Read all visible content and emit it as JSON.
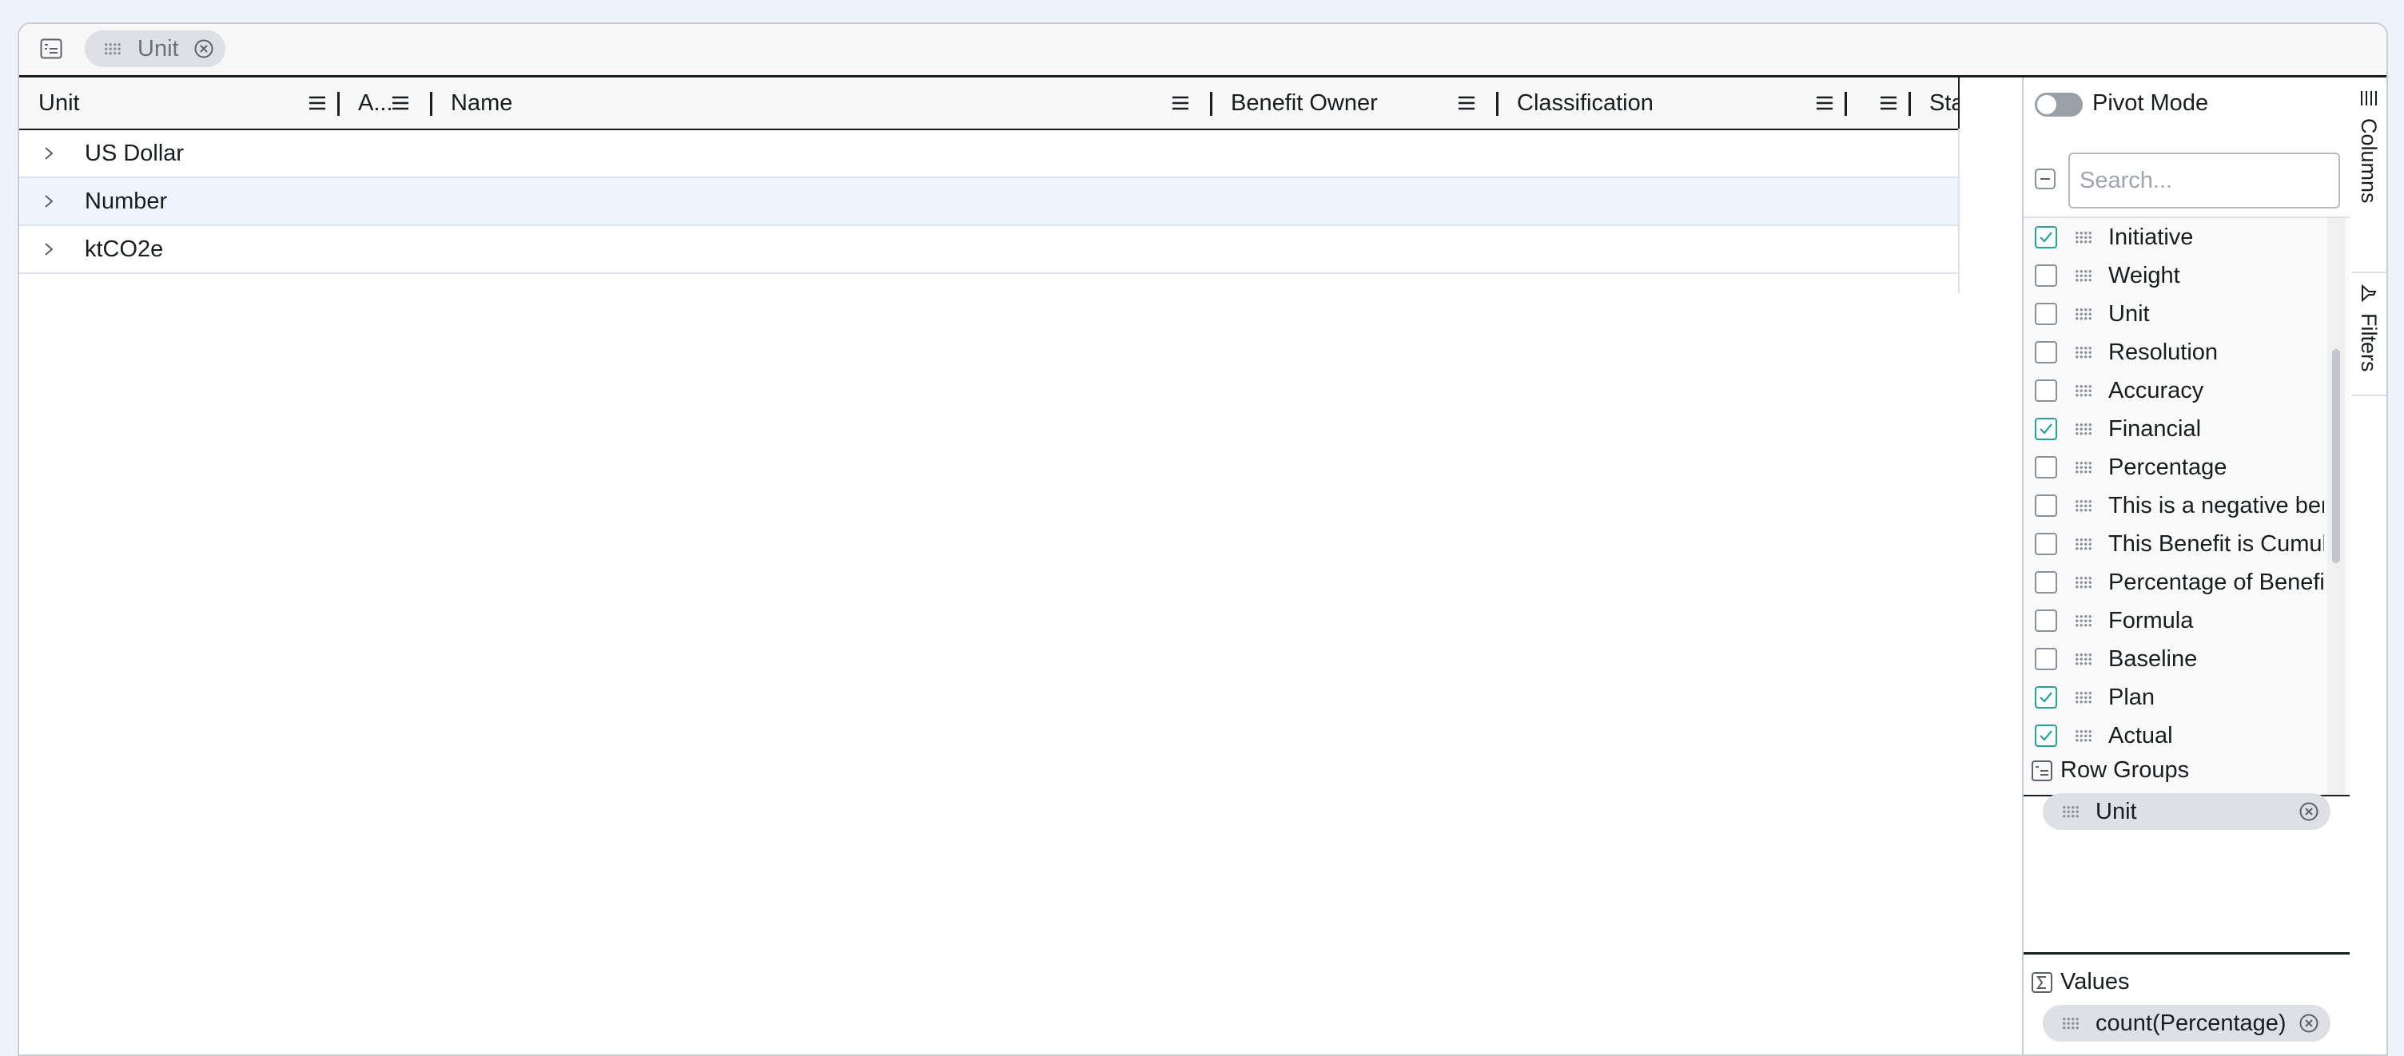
{
  "group_bar": {
    "chips": [
      {
        "label": "Unit"
      }
    ]
  },
  "header": {
    "columns": [
      {
        "label": "Unit"
      },
      {
        "label": "A..."
      },
      {
        "label": "Name"
      },
      {
        "label": "Benefit Owner"
      },
      {
        "label": "Classification"
      },
      {
        "label": ""
      },
      {
        "label": "Sta"
      }
    ]
  },
  "rows": [
    {
      "label": "US Dollar"
    },
    {
      "label": "Number"
    },
    {
      "label": "ktCO2e"
    }
  ],
  "tool_panel": {
    "pivot_mode_label": "Pivot Mode",
    "pivot_mode_on": false,
    "search_placeholder": "Search...",
    "columns": [
      {
        "label": "Initiative",
        "checked": true
      },
      {
        "label": "Weight",
        "checked": false
      },
      {
        "label": "Unit",
        "checked": false
      },
      {
        "label": "Resolution",
        "checked": false
      },
      {
        "label": "Accuracy",
        "checked": false
      },
      {
        "label": "Financial",
        "checked": true
      },
      {
        "label": "Percentage",
        "checked": false
      },
      {
        "label": "This is a negative ber",
        "checked": false
      },
      {
        "label": "This Benefit is Cumul",
        "checked": false
      },
      {
        "label": "Percentage of Benefi",
        "checked": false
      },
      {
        "label": "Formula",
        "checked": false
      },
      {
        "label": "Baseline",
        "checked": false
      },
      {
        "label": "Plan",
        "checked": true
      },
      {
        "label": "Actual",
        "checked": true
      }
    ],
    "row_groups": {
      "title": "Row Groups",
      "chips": [
        {
          "label": "Unit"
        }
      ]
    },
    "values": {
      "title": "Values",
      "chips": [
        {
          "label": "count(Percentage)"
        }
      ]
    }
  },
  "side_tabs": [
    {
      "label": "Columns",
      "icon": "columns-icon"
    },
    {
      "label": "Filters",
      "icon": "filter-icon"
    }
  ],
  "colors": {
    "page_bg": "#eef2fa",
    "row_highlight": "#eef4fd",
    "checkbox_accent": "#2aa198",
    "chip_bg": "#dde0e4"
  }
}
